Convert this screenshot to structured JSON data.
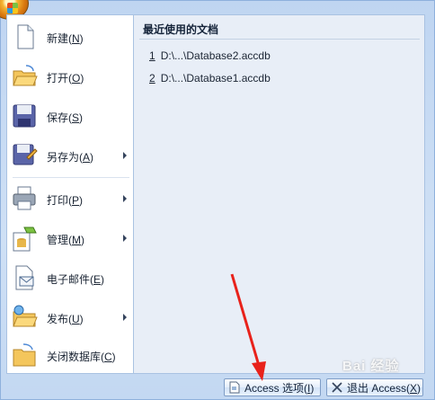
{
  "menu": {
    "items": [
      {
        "label": "新建(",
        "key": "N",
        "tail": ")",
        "icon": "new-document-icon",
        "submenu": false
      },
      {
        "label": "打开(",
        "key": "O",
        "tail": ")",
        "icon": "open-folder-icon",
        "submenu": false
      },
      {
        "label": "保存(",
        "key": "S",
        "tail": ")",
        "icon": "save-disk-icon",
        "submenu": false
      },
      {
        "label": "另存为(",
        "key": "A",
        "tail": ")",
        "icon": "save-as-icon",
        "submenu": true
      },
      {
        "label": "打印(",
        "key": "P",
        "tail": ")",
        "icon": "printer-icon",
        "submenu": true
      },
      {
        "label": "管理(",
        "key": "M",
        "tail": ")",
        "icon": "manage-database-icon",
        "submenu": true
      },
      {
        "label": "电子邮件(",
        "key": "E",
        "tail": ")",
        "icon": "email-icon",
        "submenu": false
      },
      {
        "label": "发布(",
        "key": "U",
        "tail": ")",
        "icon": "publish-folder-icon",
        "submenu": true
      },
      {
        "label": "关闭数据库(",
        "key": "C",
        "tail": ")",
        "icon": "close-database-icon",
        "submenu": false
      }
    ]
  },
  "recent": {
    "title": "最近使用的文档",
    "files": [
      {
        "num": "1",
        "path": "D:\\...\\Database2.accdb"
      },
      {
        "num": "2",
        "path": "D:\\...\\Database1.accdb"
      }
    ]
  },
  "bottom": {
    "options_label": "Access 选项(",
    "options_key": "I",
    "options_tail": ")",
    "exit_label": "退出 Access(",
    "exit_key": "X",
    "exit_tail": ")"
  },
  "watermark": "Bai 经验",
  "colors": {
    "frame": "#c9dcf3",
    "annotation_arrow": "#e8221b",
    "panel_bg": "#e8eef7"
  }
}
